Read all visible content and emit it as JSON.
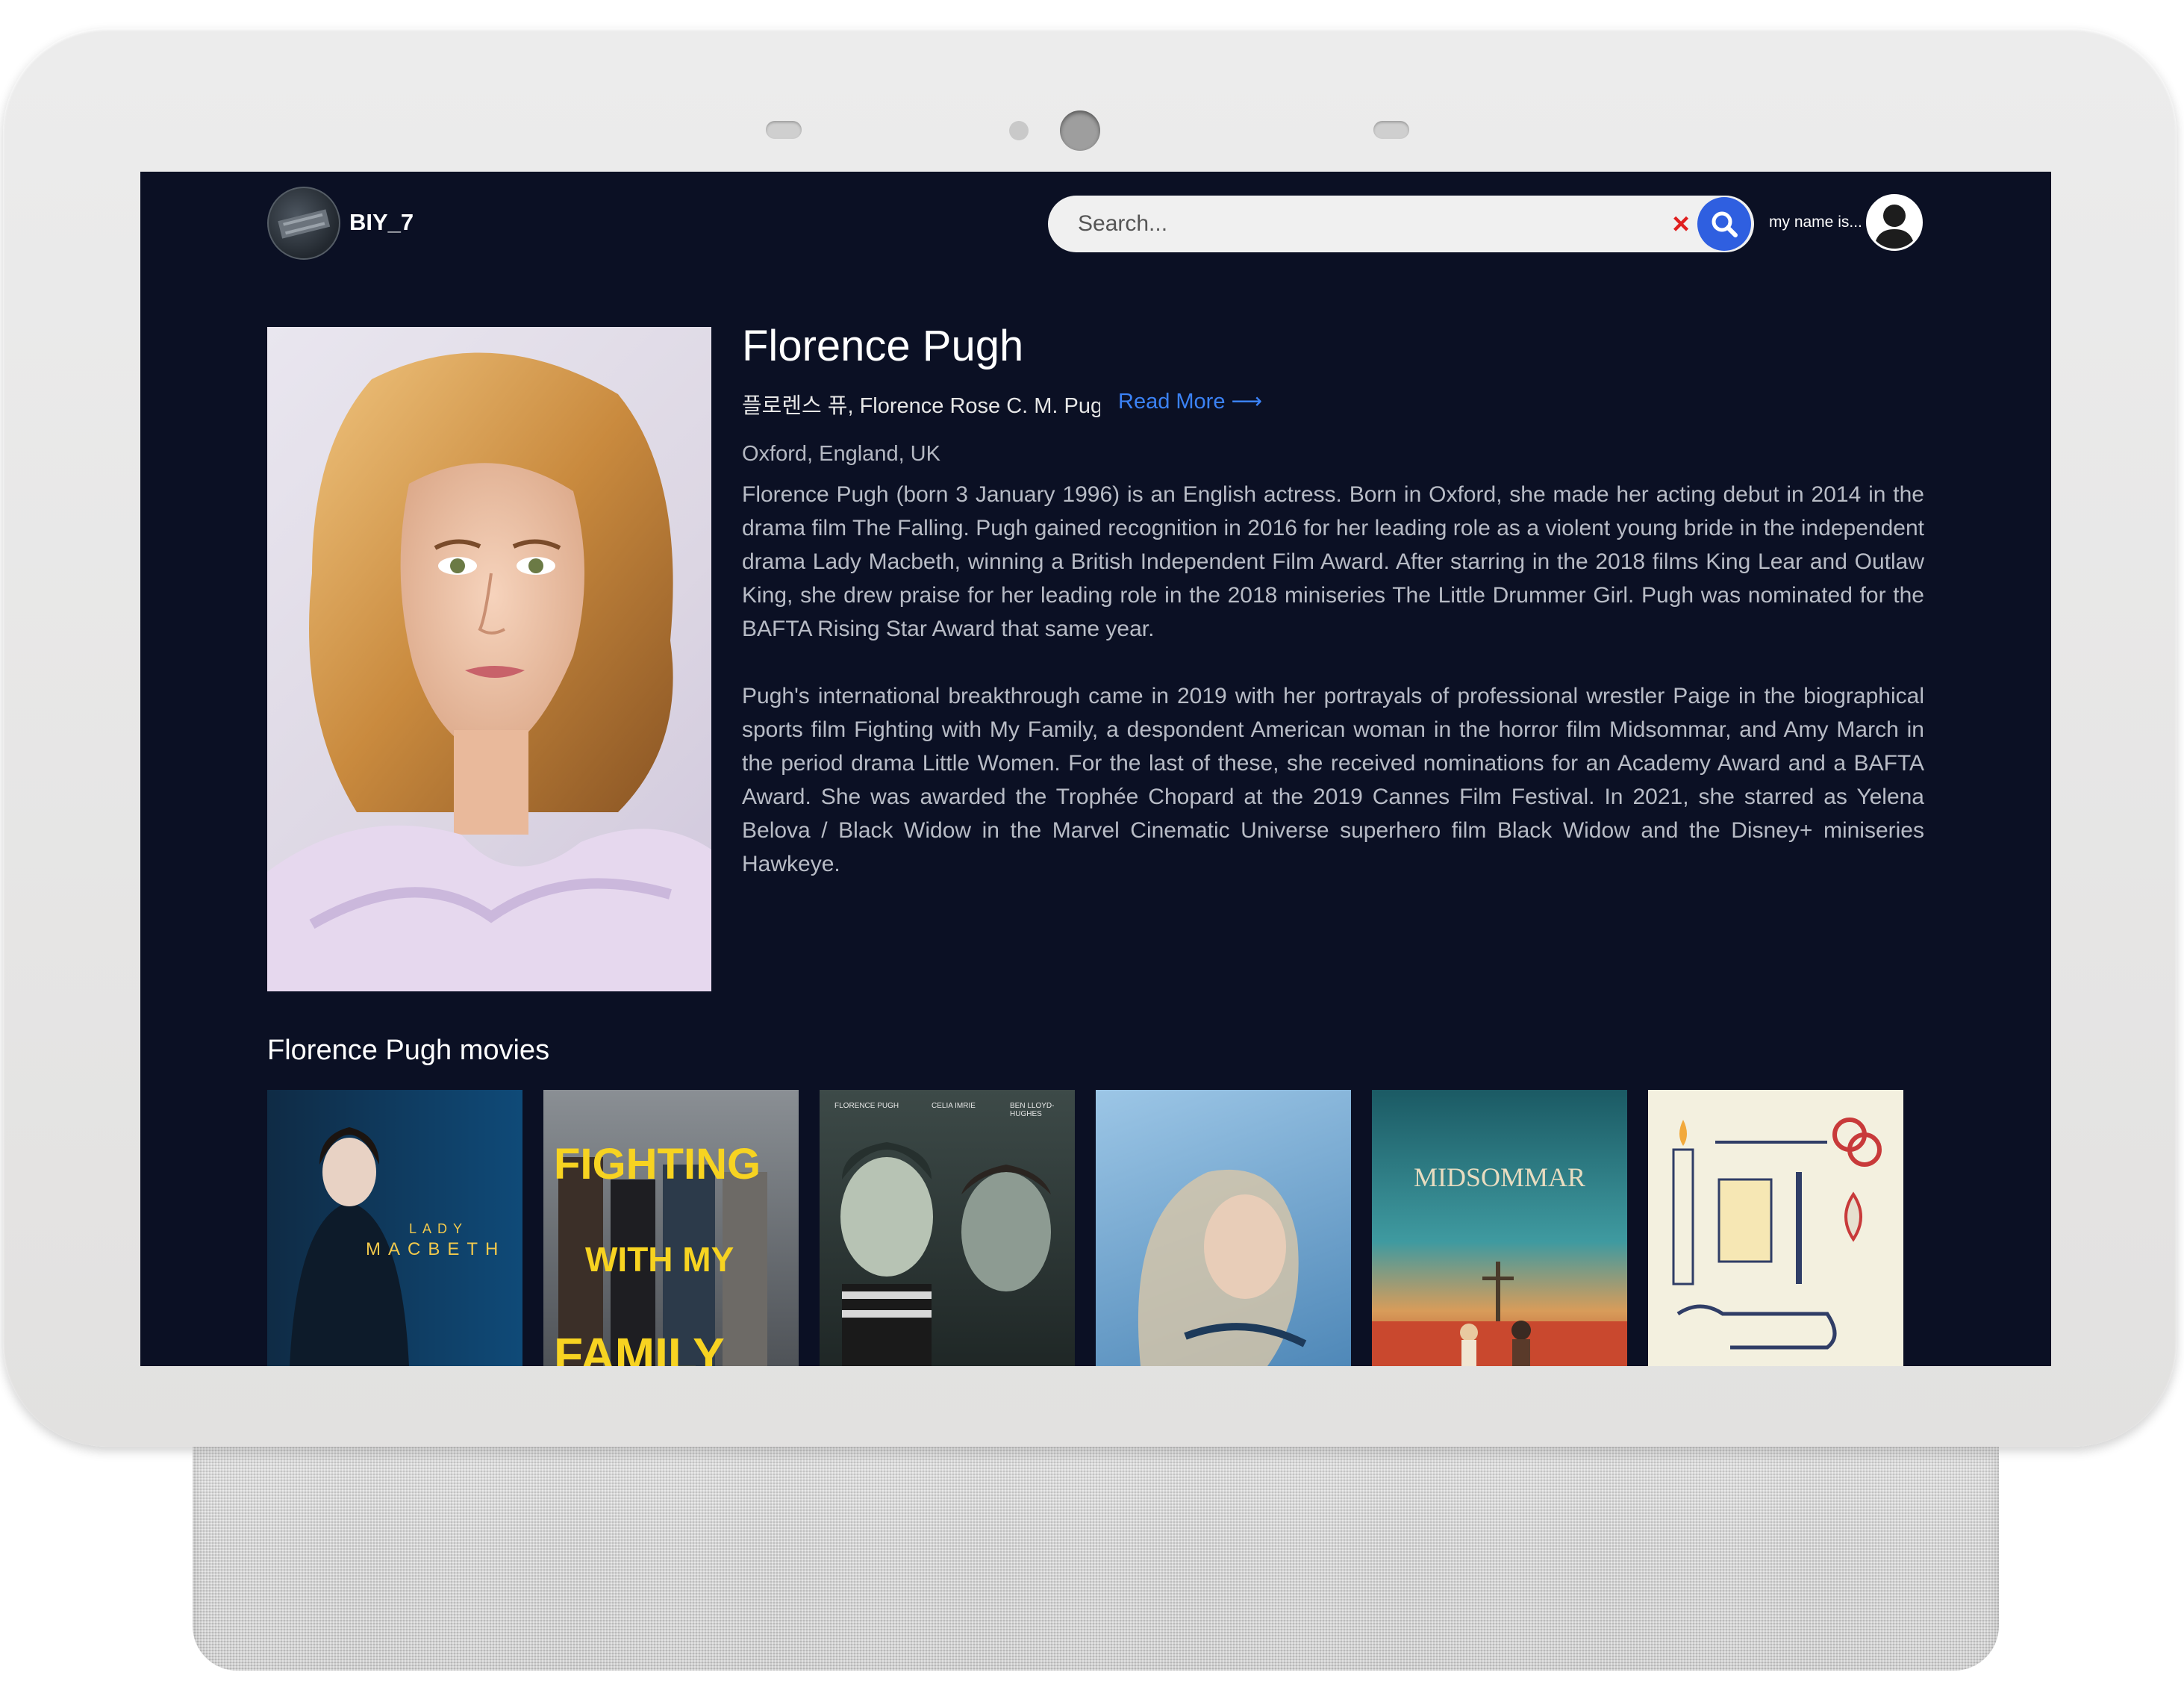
{
  "header": {
    "logo_text": "BIY_7",
    "search": {
      "placeholder": "Search..."
    },
    "clear_label": "×",
    "user_label": "my name is..."
  },
  "person": {
    "name": "Florence Pugh",
    "also_known_as": "플로렌스 퓨, Florence Rose C. M. Pugh",
    "read_more": "Read More ⟶",
    "birthplace": "Oxford, England, UK",
    "bio": [
      "Florence Pugh (born 3 January 1996) is an English actress. Born in Oxford, she made her acting debut in 2014 in the drama film The Falling. Pugh gained recognition in 2016 for her leading role as a violent young bride in the independent drama Lady Macbeth, winning a British Independent Film Award. After starring in the 2018 films King Lear and Outlaw King, she drew praise for her leading role in the 2018 miniseries The Little Drummer Girl. Pugh was nominated for the BAFTA Rising Star Award that same year.",
      "Pugh's international breakthrough came in 2019 with her portrayals of professional wrestler Paige in the biographical sports film Fighting with My Family, a despondent American woman in the horror film Midsommar, and Amy March in the period drama Little Women. For the last of these, she received nominations for an Academy Award and a BAFTA Award. She was awarded the Trophée Chopard at the 2019 Cannes Film Festival. In 2021, she starred as Yelena Belova / Black Widow in the Marvel Cinematic Universe superhero film Black Widow and the Disney+ miniseries Hawkeye."
    ]
  },
  "movies": {
    "heading": "Florence Pugh movies",
    "posters": [
      {
        "title_top": "LADY",
        "title_bottom": "MACBETH"
      },
      {
        "line1": "FIGHTING",
        "line2": "WITH MY",
        "line3": "FAMILY"
      },
      {
        "credits": [
          "FLORENCE PUGH",
          "CELIA IMRIE",
          "BEN LLOYD-HUGHES"
        ]
      },
      {},
      {
        "title": "MIDSOMMAR"
      },
      {}
    ]
  }
}
